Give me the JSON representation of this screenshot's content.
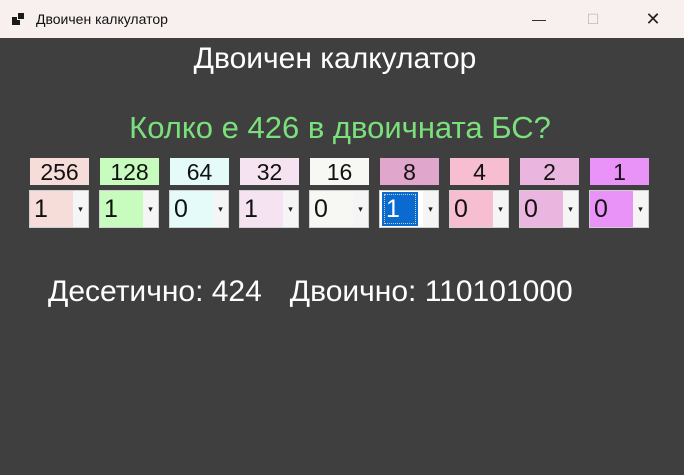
{
  "window": {
    "title": "Двоичен калкулатор",
    "minimize": "—",
    "maximize": "☐",
    "close": "✕"
  },
  "heading": "Двоичен калкулатор",
  "question": "Колко е 426 в двоичната БС?",
  "bits": [
    {
      "label": "256",
      "value": "1",
      "color": "#f6ddd9"
    },
    {
      "label": "128",
      "value": "1",
      "color": "#c8fbbe"
    },
    {
      "label": "64",
      "value": "0",
      "color": "#e5fbfa"
    },
    {
      "label": "32",
      "value": "1",
      "color": "#f5e3f2"
    },
    {
      "label": "16",
      "value": "0",
      "color": "#f7f7f4"
    },
    {
      "label": "8",
      "value": "1",
      "color": "#e1a6cc",
      "selected": true
    },
    {
      "label": "4",
      "value": "0",
      "color": "#f7bdd0"
    },
    {
      "label": "2",
      "value": "0",
      "color": "#eab6e0"
    },
    {
      "label": "1",
      "value": "0",
      "color": "#e993f8"
    }
  ],
  "result": {
    "decimal_label": "Десетично: 424",
    "binary_label": "Двоично: 110101000"
  }
}
